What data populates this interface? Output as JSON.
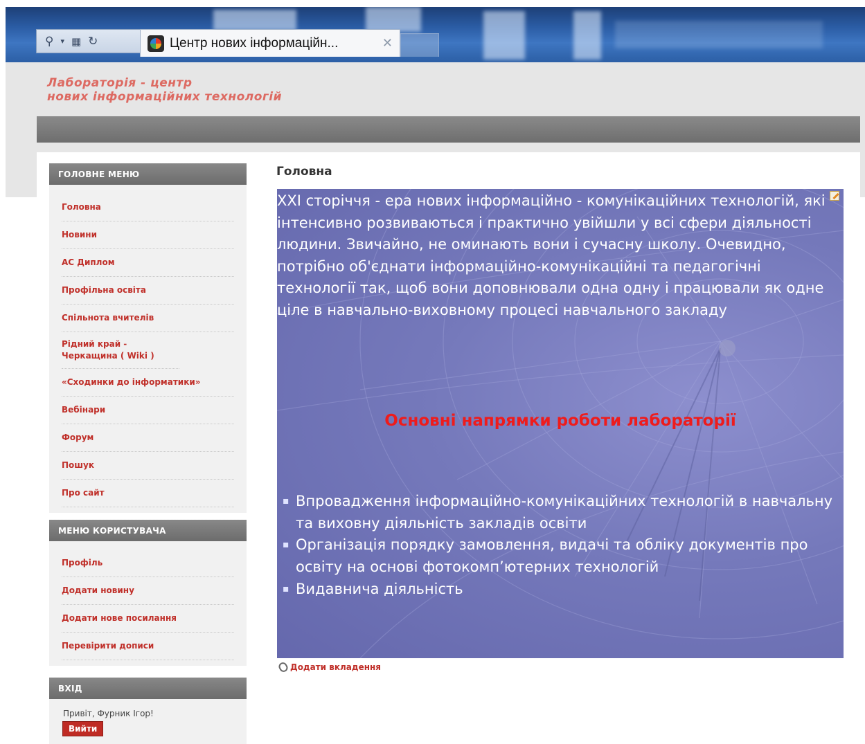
{
  "browser": {
    "tab_title": "Центр нових інформаційн...",
    "address_tools": [
      "search-icon",
      "dropdown-arrow-icon",
      "compatibility-icon",
      "refresh-icon"
    ],
    "close_glyph": "✕"
  },
  "site": {
    "logo_line1": "Лабораторія - центр",
    "logo_line2": "нових інформаційних технологій"
  },
  "sidebar": {
    "main_menu": {
      "title": "ГОЛОВНЕ МЕНЮ",
      "items": [
        {
          "label": "Головна"
        },
        {
          "label": "Новини"
        },
        {
          "label": "АС Диплом"
        },
        {
          "label": "Профільна освіта"
        },
        {
          "label": "Спільнота вчителів"
        },
        {
          "label": "Рідний край - Черкащина ( Wiki )"
        },
        {
          "label": "«Сходинки до інформатики»"
        },
        {
          "label": "Вебінари"
        },
        {
          "label": "Форум"
        },
        {
          "label": "Пошук"
        },
        {
          "label": "Про сайт"
        }
      ]
    },
    "user_menu": {
      "title": "МЕНЮ КОРИСТУВАЧА",
      "items": [
        {
          "label": "Профіль"
        },
        {
          "label": "Додати новину"
        },
        {
          "label": "Додати нове посилання"
        },
        {
          "label": "Перевірити дописи"
        }
      ]
    },
    "login": {
      "title": "ВХІД",
      "greeting": "Привіт, Фурник Ігор!",
      "logout_label": "Вийти"
    }
  },
  "main": {
    "title": "Головна",
    "intro": "XXI сторіччя - ера нових інформаційно - комунікаційних технологій, які інтенсивно розвиваються і практично увійшли у всі сфери діяльності людини. Звичайно, не оминають вони і сучасну школу. Очевидно, потрібно об'єднати інформаційно-комунікаційні та педагогічні технології так, щоб вони доповнювали одна одну і працювали як одне ціле в навчально-виховному процесі навчального закладу",
    "heading": "Основні напрямки роботи лабораторії",
    "bullets": [
      {
        "text": "Впровадження інформаційно-комунікаційних технологій в навчальну та виховну діяльність закладів освіти"
      },
      {
        "text": "Організація порядку замовлення, видачі та обліку документів про освіту на основі фотокомп’ютерних технологій"
      },
      {
        "text": "Видавнича діяльність"
      }
    ],
    "attach_label": "Додати вкладення"
  },
  "colors": {
    "accent_red": "#c0302a",
    "banner_blue": "#7579bb",
    "header_gray": "#7a7a7a"
  }
}
